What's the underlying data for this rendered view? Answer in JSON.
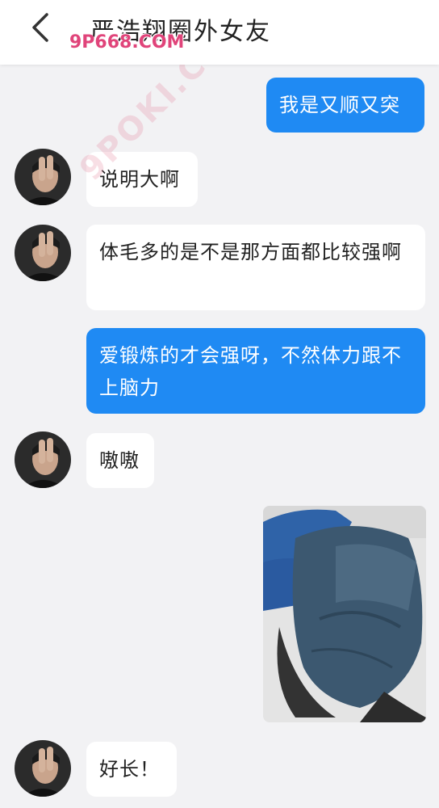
{
  "header": {
    "title": "严浩翔圈外女友",
    "watermark": "9P668.COM"
  },
  "watermark_diagonal": "9POKI.COM",
  "messages": [
    {
      "direction": "out",
      "text": "我是又顺又突"
    },
    {
      "direction": "in",
      "text": "说明大啊"
    },
    {
      "direction": "in",
      "text": "体毛多的是不是那方面都比较强啊"
    },
    {
      "direction": "out",
      "text": "爱锻炼的才会强呀，不然体力跟不上脑力"
    },
    {
      "direction": "in",
      "text": "嗷嗷"
    },
    {
      "direction": "out",
      "type": "image",
      "description": ""
    },
    {
      "direction": "in",
      "text": "好长！"
    }
  ],
  "colors": {
    "background": "#f2f2f4",
    "outgoing_bubble": "#1f8af3",
    "incoming_bubble": "#ffffff",
    "header": "#ffffff"
  },
  "icons": {
    "back": "chevron-left-icon"
  }
}
